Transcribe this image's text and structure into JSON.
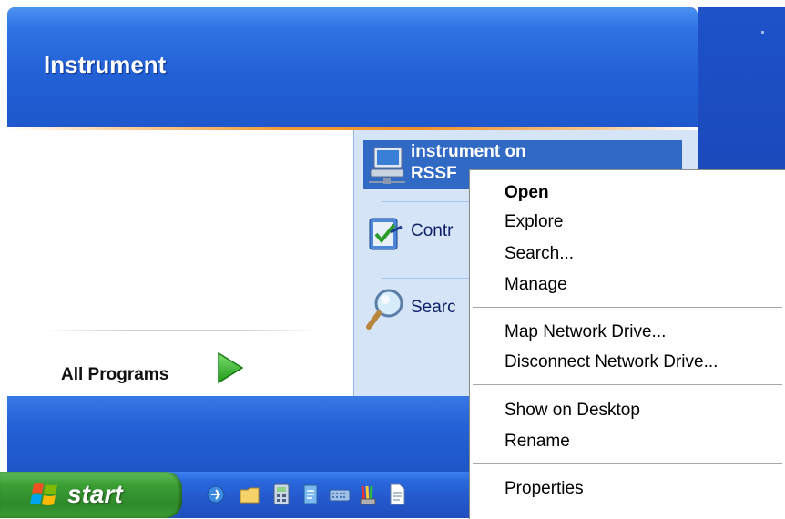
{
  "start_menu": {
    "title": "Instrument",
    "all_programs_label": "All Programs",
    "right_items": {
      "network_drive_line1": "instrument on",
      "network_drive_line2": "RSSF",
      "control_panel_label": "Contr",
      "search_label": "Searc"
    }
  },
  "taskbar": {
    "start_label": "start",
    "quick_launch_icons": [
      "ie-icon",
      "folder-icon",
      "calculator-icon",
      "notepad-icon",
      "keyboard-icon",
      "paint-icon",
      "document-icon"
    ]
  },
  "context_menu": {
    "items": [
      {
        "label": "Open",
        "bold": true
      },
      {
        "label": "Explore"
      },
      {
        "label": "Search..."
      },
      {
        "label": "Manage"
      },
      {
        "label": "Map Network Drive..."
      },
      {
        "label": "Disconnect Network Drive..."
      },
      {
        "label": "Show on Desktop"
      },
      {
        "label": "Rename"
      },
      {
        "label": "Properties"
      }
    ]
  },
  "colors": {
    "menu_blue": "#1f5bd1",
    "selection_blue": "#316ac5",
    "right_pane": "#d6e4f7",
    "orange_accent": "#f2902a",
    "start_green": "#3a9e33"
  }
}
